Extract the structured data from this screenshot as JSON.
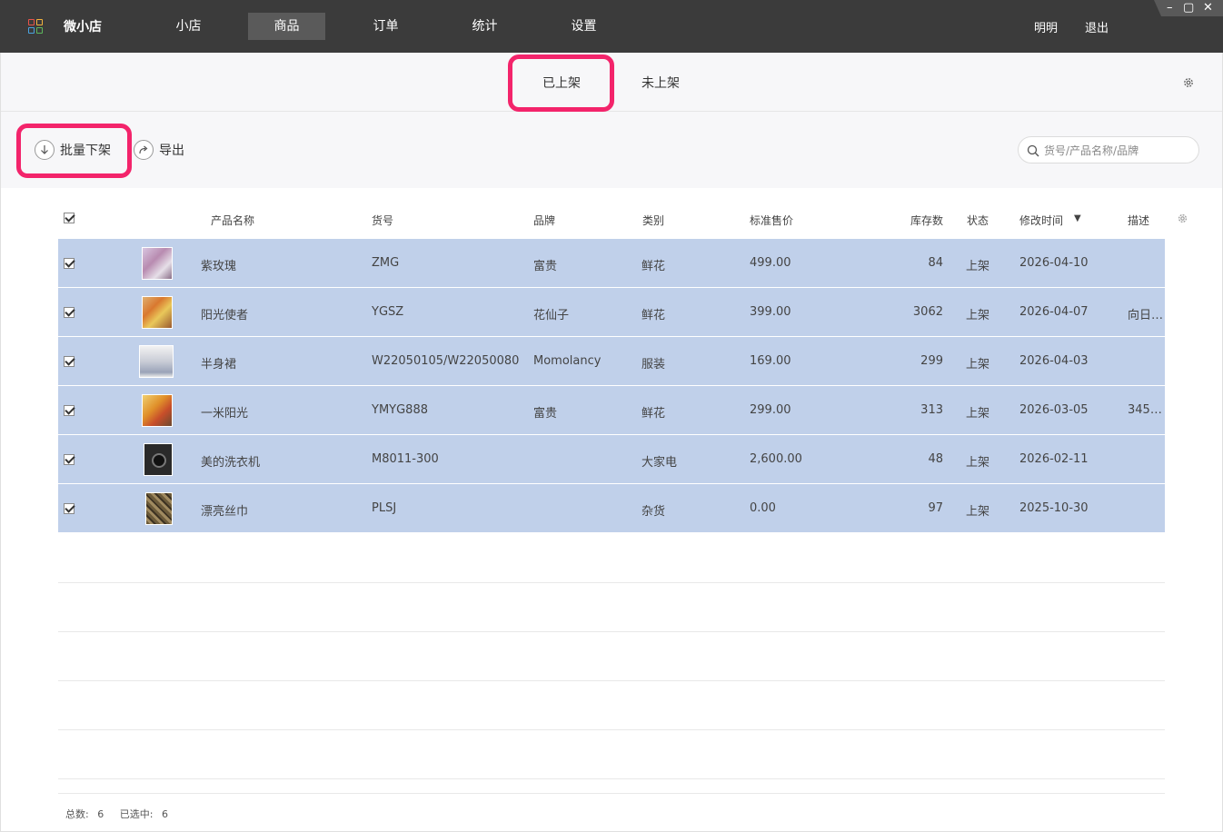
{
  "app": {
    "title": "微小店",
    "nav": [
      "小店",
      "商品",
      "订单",
      "统计",
      "设置"
    ],
    "active_nav": "商品",
    "user": "明明",
    "logout": "退出",
    "window_controls": [
      "–",
      "▢",
      "✕"
    ]
  },
  "tabs": {
    "on_shelf": "已上架",
    "off_shelf": "未上架",
    "active": "已上架"
  },
  "toolbar": {
    "batch_off_label": "批量下架",
    "export_label": "导出",
    "search_placeholder": "货号/产品名称/品牌"
  },
  "table": {
    "columns": {
      "name": "产品名称",
      "sku": "货号",
      "brand": "品牌",
      "category": "类别",
      "price": "标准售价",
      "stock": "库存数",
      "status": "状态",
      "modified": "修改时间",
      "sort_indicator": "▼",
      "desc": "描述"
    },
    "rows": [
      {
        "name": "紫玫瑰",
        "sku": "ZMG",
        "brand": "富贵",
        "category": "鲜花",
        "price": "499.00",
        "stock": "84",
        "status": "上架",
        "modified": "2026-04-10",
        "desc": ""
      },
      {
        "name": "阳光使者",
        "sku": "YGSZ",
        "brand": "花仙子",
        "category": "鲜花",
        "price": "399.00",
        "stock": "3062",
        "status": "上架",
        "modified": "2026-04-07",
        "desc": "向日…"
      },
      {
        "name": "半身裙",
        "sku": "W22050105/W22050080",
        "brand": "Momolancy",
        "category": "服装",
        "price": "169.00",
        "stock": "299",
        "status": "上架",
        "modified": "2026-04-03",
        "desc": ""
      },
      {
        "name": "一米阳光",
        "sku": "YMYG888",
        "brand": "富贵",
        "category": "鲜花",
        "price": "299.00",
        "stock": "313",
        "status": "上架",
        "modified": "2026-03-05",
        "desc": "345…"
      },
      {
        "name": "美的洗衣机",
        "sku": "M8011-300",
        "brand": "",
        "category": "大家电",
        "price": "2,600.00",
        "stock": "48",
        "status": "上架",
        "modified": "2026-02-11",
        "desc": ""
      },
      {
        "name": "漂亮丝巾",
        "sku": "PLSJ",
        "brand": "",
        "category": "杂货",
        "price": "0.00",
        "stock": "97",
        "status": "上架",
        "modified": "2025-10-30",
        "desc": ""
      }
    ]
  },
  "footer": {
    "total_label": "总数:",
    "total": "6",
    "selected_label": "已选中:",
    "selected": "6"
  },
  "colors": {
    "topbar": "#3b3b3b",
    "selected_row": "#c0d0ea",
    "highlight": "#f3246b"
  }
}
